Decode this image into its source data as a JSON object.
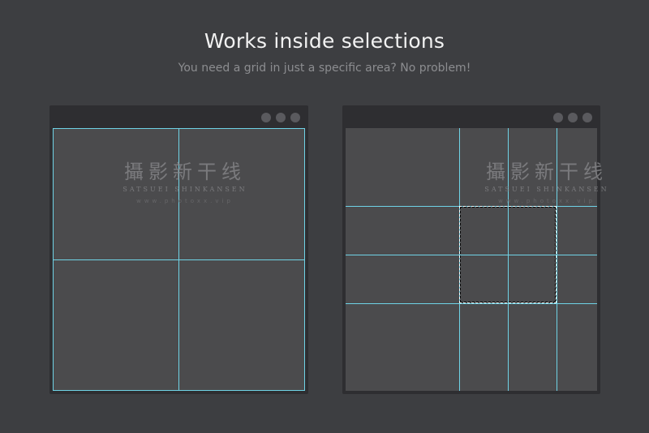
{
  "header": {
    "title": "Works inside selections",
    "subtitle": "You need a grid in just a specific area? No problem!"
  },
  "watermark": {
    "cn": "攝影新干线",
    "en": "SATSUEI SHINKANSEN",
    "url": "www.photoxx.vip"
  },
  "colors": {
    "background": "#3d3e41",
    "window": "#2e2e31",
    "canvas": "#4b4b4d",
    "guide": "#6fd3e6"
  }
}
